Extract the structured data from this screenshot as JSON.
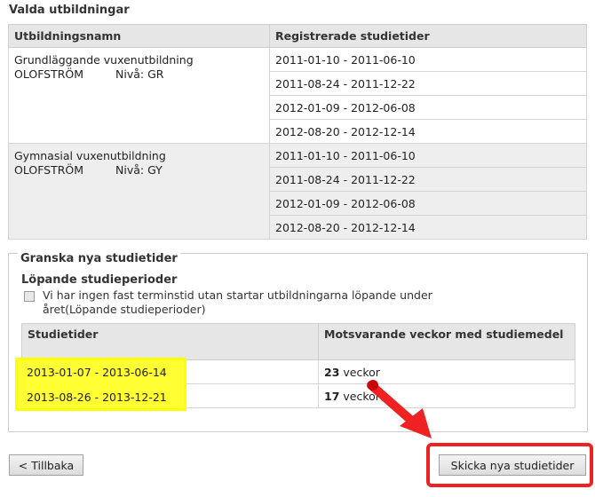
{
  "title": "Valda utbildningar",
  "registered_table": {
    "headers": [
      "Utbildningsnamn",
      "Registrerade studietider"
    ],
    "groups": [
      {
        "name": "Grundläggande vuxenutbildning",
        "place": "OLOFSTRÖM",
        "level": "Nivå: GR",
        "periods": [
          "2011-01-10 - 2011-06-10",
          "2011-08-24 - 2011-12-22",
          "2012-01-09 - 2012-06-08",
          "2012-08-20 - 2012-12-14"
        ]
      },
      {
        "name": "Gymnasial vuxenutbildning",
        "place": "OLOFSTRÖM",
        "level": "Nivå: GY",
        "periods": [
          "2011-01-10 - 2011-06-10",
          "2011-08-24 - 2011-12-22",
          "2012-01-09 - 2012-06-08",
          "2012-08-20 - 2012-12-14"
        ]
      }
    ]
  },
  "review": {
    "legend": "Granska nya studietider",
    "subtitle": "Löpande studieperioder",
    "checkbox_label": "Vi har ingen fast terminstid utan startar utbildningarna löpande under året(Löpande studieperioder)",
    "headers": [
      "Studietider",
      "Motsvarande veckor med studiemedel"
    ],
    "rows": [
      {
        "period": "2013-01-07 - 2013-06-14",
        "weeks": "23",
        "unit": "veckor"
      },
      {
        "period": "2013-08-26 - 2013-12-21",
        "weeks": "17",
        "unit": "veckor"
      }
    ]
  },
  "buttons": {
    "back": "< Tillbaka",
    "send": "Skicka nya studietider"
  },
  "colors": {
    "highlight": "#ffff33",
    "annotation": "#e22222"
  }
}
